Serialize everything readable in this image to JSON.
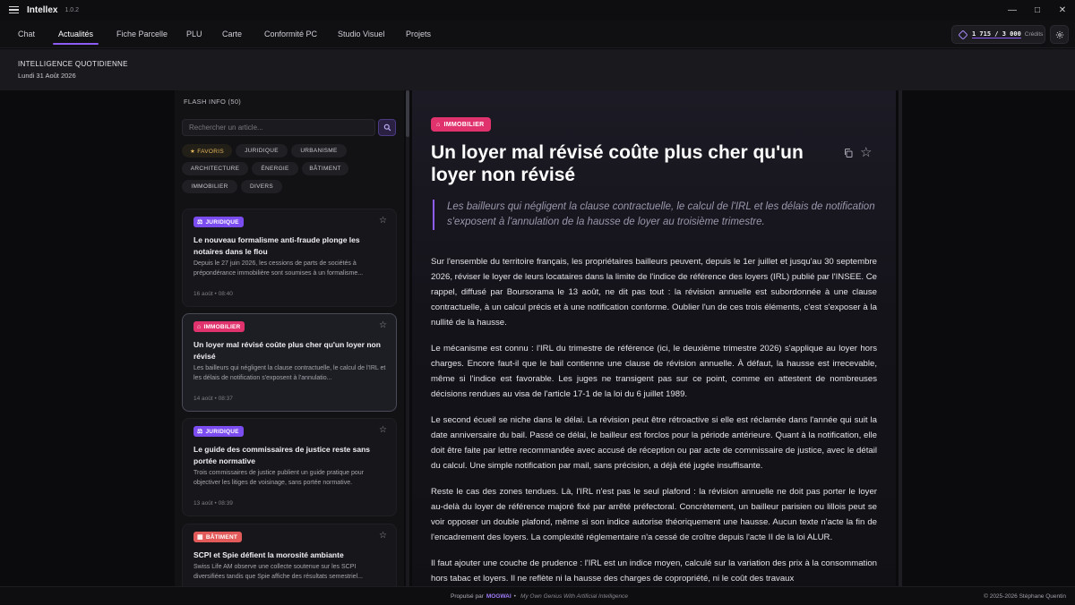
{
  "app": {
    "name": "Intellex",
    "version": "1.0.2"
  },
  "window_controls": {
    "minimize": "—",
    "maximize": "□",
    "close": "✕"
  },
  "nav": {
    "tabs": [
      {
        "label": "Chat"
      },
      {
        "label": "Actualités",
        "active": true
      },
      {
        "label": "Fiche Parcelle"
      },
      {
        "label": "PLU"
      },
      {
        "label": "Carte"
      },
      {
        "label": "Conformité PC"
      },
      {
        "label": "Studio Visuel"
      },
      {
        "label": "Projets"
      }
    ],
    "credits": {
      "value": "1 715 / 3 000",
      "label": "Crédits",
      "icon": "credits-icon"
    },
    "settings_icon": "gear-icon"
  },
  "header": {
    "title": "INTELLIGENCE QUOTIDIENNE",
    "date": "Lundi 31 Août 2026"
  },
  "flash": {
    "title": "FLASH INFO (50)",
    "search_placeholder": "Rechercher un article...",
    "filters": [
      "★ FAVORIS",
      "JURIDIQUE",
      "URBANISME",
      "ARCHITECTURE",
      "ÉNERGIE",
      "BÂTIMENT",
      "IMMOBILIER",
      "DIVERS"
    ],
    "cards": [
      {
        "category": "JURIDIQUE",
        "title": "Le nouveau formalisme anti-fraude plonge les notaires dans le flou",
        "excerpt": "Depuis le 27 juin 2026, les cessions de parts de sociétés à prépondérance immobilière sont soumises à un formalisme...",
        "date": "16 août • 08:40"
      },
      {
        "category": "IMMOBILIER",
        "title": "Un loyer mal révisé coûte plus cher qu'un loyer non révisé",
        "excerpt": "Les bailleurs qui négligent la clause contractuelle, le calcul de l'IRL et les délais de notification s'exposent à l'annulatio...",
        "date": "14 août • 08:37",
        "selected": true
      },
      {
        "category": "JURIDIQUE",
        "title": "Le guide des commissaires de justice reste sans portée normative",
        "excerpt": "Trois commissaires de justice publient un guide pratique pour objectiver les litiges de voisinage, sans portée normative.",
        "date": "13 août • 08:39"
      },
      {
        "category": "BÂTIMENT",
        "title": "SCPI et Spie défient la morosité ambiante",
        "excerpt": "Swiss Life AM observe une collecte soutenue sur les SCPI diversifiées tandis que Spie affiche des résultats semestriel..."
      }
    ]
  },
  "article": {
    "category": "IMMOBILIER",
    "title": "Un loyer mal révisé coûte plus cher qu'un loyer non révisé",
    "lead": "Les bailleurs qui négligent la clause contractuelle, le calcul de l'IRL et les délais de notification s'exposent à l'annulation de la hausse de loyer au troisième trimestre.",
    "paragraphs": [
      "Sur l'ensemble du territoire français, les propriétaires bailleurs peuvent, depuis le 1er juillet et jusqu'au 30 septembre 2026, réviser le loyer de leurs locataires dans la limite de l'indice de référence des loyers (IRL) publié par l'INSEE. Ce rappel, diffusé par Boursorama le 13 août, ne dit pas tout : la révision annuelle est subordonnée à une clause contractuelle, à un calcul précis et à une notification conforme. Oublier l'un de ces trois éléments, c'est s'exposer à la nullité de la hausse.",
      "Le mécanisme est connu : l'IRL du trimestre de référence (ici, le deuxième trimestre 2026) s'applique au loyer hors charges. Encore faut-il que le bail contienne une clause de révision annuelle. À défaut, la hausse est irrecevable, même si l'indice est favorable. Les juges ne transigent pas sur ce point, comme en attestent de nombreuses décisions rendues au visa de l'article 17-1 de la loi du 6 juillet 1989.",
      "Le second écueil se niche dans le délai. La révision peut être rétroactive si elle est réclamée dans l'année qui suit la date anniversaire du bail. Passé ce délai, le bailleur est forclos pour la période antérieure. Quant à la notification, elle doit être faite par lettre recommandée avec accusé de réception ou par acte de commissaire de justice, avec le détail du calcul. Une simple notification par mail, sans précision, a déjà été jugée insuffisante.",
      "Reste le cas des zones tendues. Là, l'IRL n'est pas le seul plafond : la révision annuelle ne doit pas porter le loyer au-delà du loyer de référence majoré fixé par arrêté préfectoral. Concrètement, un bailleur parisien ou lillois peut se voir opposer un double plafond, même si son indice autorise théoriquement une hausse. Aucun texte n'acte la fin de l'encadrement des loyers. La complexité réglementaire n'a cessé de croître depuis l'acte II de la loi ALUR.",
      "Il faut ajouter une couche de prudence : l'IRL est un indice moyen, calculé sur la variation des prix à la consommation hors tabac et loyers. Il ne reflète ni la hausse des charges de copropriété, ni le coût des travaux"
    ]
  },
  "footer": {
    "prefix": "Propulsé par",
    "brand": "MOGWAI",
    "separator": "•",
    "tagline": "My Own Genius With Artificial Intelligence",
    "copyright": "© 2025-2026 Stéphane Quentin"
  }
}
